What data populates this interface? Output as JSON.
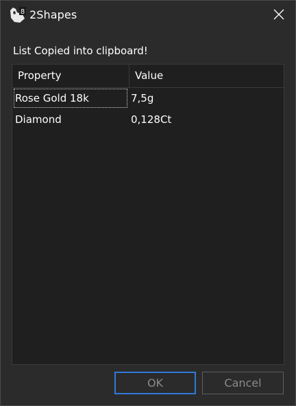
{
  "window": {
    "title": "2Shapes",
    "app_icon": "rhino-8-icon",
    "close_icon": "close-icon"
  },
  "message": "List Copied into clipboard!",
  "list": {
    "columns": [
      "Property",
      "Value"
    ],
    "rows": [
      {
        "property": "Rose Gold 18k",
        "value": "7,5g"
      },
      {
        "property": "Diamond",
        "value": "0,128Ct"
      }
    ]
  },
  "buttons": {
    "ok": "OK",
    "cancel": "Cancel"
  },
  "colors": {
    "background": "#2b2b2b",
    "list_background": "#1f1f1f",
    "accent": "#2f7ad9"
  }
}
